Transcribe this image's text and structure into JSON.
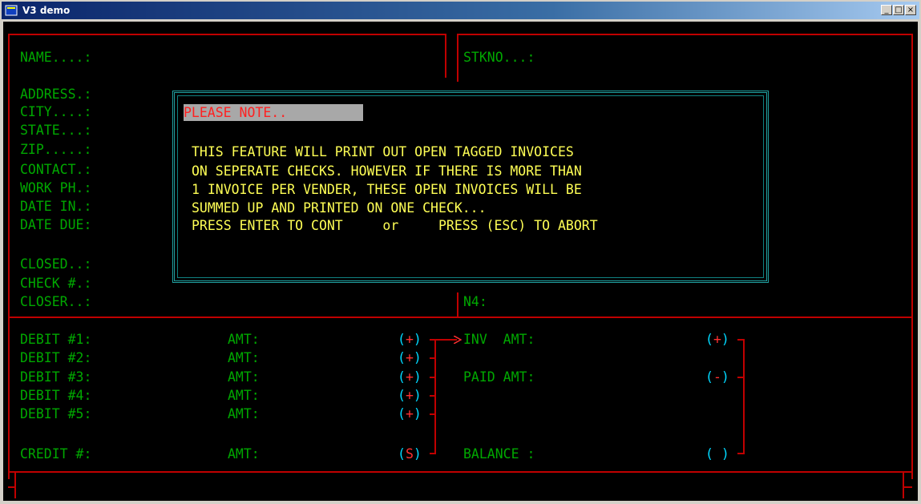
{
  "window": {
    "title": "V3 demo",
    "min_label": "_",
    "max_label": "□",
    "close_label": "×"
  },
  "top_left_labels": [
    "NAME....:",
    "ADDRESS.:",
    "CITY....:",
    "STATE...:",
    "ZIP.....:",
    "CONTACT.:",
    "WORK PH.:",
    "DATE IN.:",
    "DATE DUE:",
    "CLOSED..:",
    "CHECK #.:",
    "CLOSER..:"
  ],
  "top_right_labels": {
    "stkno": "STKNO...:",
    "n4": "N4:"
  },
  "dialog": {
    "header": "PLEASE NOTE..",
    "lines": [
      "THIS FEATURE WILL PRINT OUT OPEN TAGGED INVOICES",
      "ON SEPERATE CHECKS. HOWEVER IF THERE IS MORE THAN",
      "1 INVOICE PER VENDER, THESE OPEN INVOICES WILL BE",
      "SUMMED UP AND PRINTED ON ONE CHECK...",
      "PRESS ENTER TO CONT     or     PRESS (ESC) TO ABORT"
    ]
  },
  "bottom": {
    "debits": [
      "DEBIT #1:",
      "DEBIT #2:",
      "DEBIT #3:",
      "DEBIT #4:",
      "DEBIT #5:"
    ],
    "credit": "CREDIT #:",
    "amt_label": "AMT:",
    "plus_sign": "(+)",
    "minus_sign": "(-)",
    "s_sign": "(S)",
    "blank_sign": "( )",
    "arrow": "─→",
    "inv_amt": "INV  AMT:",
    "paid_amt": "PAID AMT:",
    "balance": "BALANCE :"
  }
}
